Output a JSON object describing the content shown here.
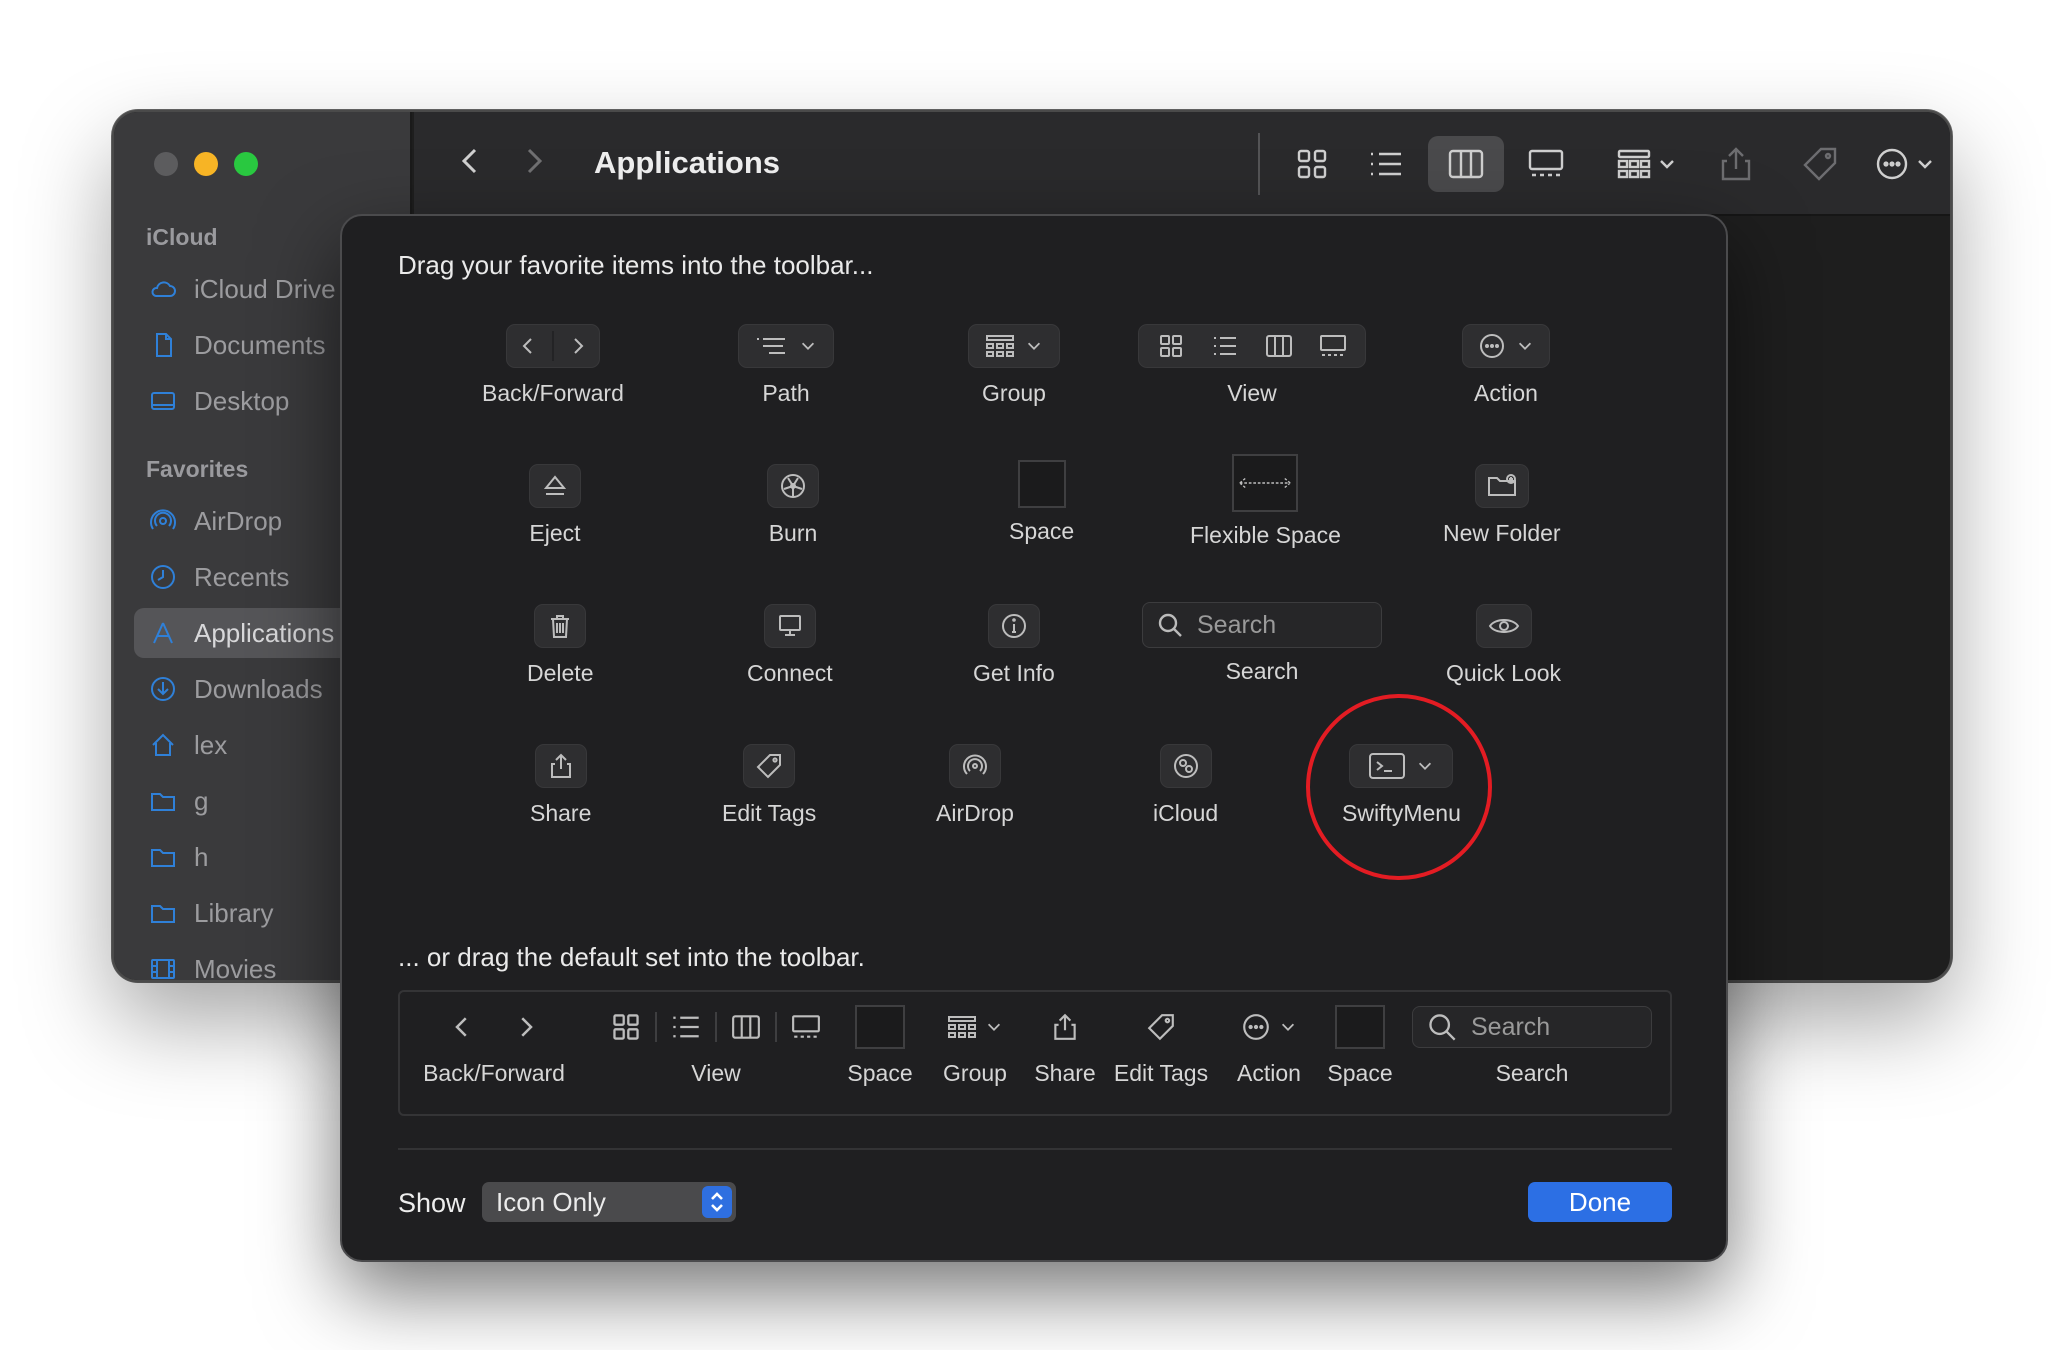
{
  "finder": {
    "title": "Applications",
    "sidebar": {
      "icloud_heading": "iCloud",
      "icloud_items": [
        {
          "label": "iCloud Drive",
          "icon": "cloud-icon"
        },
        {
          "label": "Documents",
          "icon": "document-icon"
        },
        {
          "label": "Desktop",
          "icon": "desktop-icon"
        }
      ],
      "favorites_heading": "Favorites",
      "favorite_items": [
        {
          "label": "AirDrop",
          "icon": "airdrop-icon"
        },
        {
          "label": "Recents",
          "icon": "clock-icon"
        },
        {
          "label": "Applications",
          "icon": "applications-icon",
          "selected": true
        },
        {
          "label": "Downloads",
          "icon": "download-icon"
        },
        {
          "label": "lex",
          "icon": "home-icon"
        },
        {
          "label": "g",
          "icon": "folder-icon"
        },
        {
          "label": "h",
          "icon": "folder-icon"
        },
        {
          "label": "Library",
          "icon": "folder-icon"
        },
        {
          "label": "Movies",
          "icon": "film-icon"
        }
      ]
    },
    "toolbar": {
      "view_modes": [
        "icon-view",
        "list-view",
        "column-view",
        "gallery-view"
      ],
      "selected_view": "column-view"
    }
  },
  "customize": {
    "instruction": "Drag your favorite items into the toolbar...",
    "palette": {
      "back_forward": "Back/Forward",
      "path": "Path",
      "group": "Group",
      "view": "View",
      "action": "Action",
      "eject": "Eject",
      "burn": "Burn",
      "space": "Space",
      "flexible_space": "Flexible Space",
      "new_folder": "New Folder",
      "delete": "Delete",
      "connect": "Connect",
      "get_info": "Get Info",
      "search_placeholder": "Search",
      "search": "Search",
      "quick_look": "Quick Look",
      "share": "Share",
      "edit_tags": "Edit Tags",
      "airdrop": "AirDrop",
      "icloud": "iCloud",
      "swiftymenu": "SwiftyMenu"
    },
    "default_instruction": "... or drag the default set into the toolbar.",
    "default_set": {
      "back_forward": "Back/Forward",
      "view": "View",
      "space1": "Space",
      "group": "Group",
      "share": "Share",
      "edit_tags": "Edit Tags",
      "action": "Action",
      "space2": "Space",
      "search_placeholder": "Search",
      "search": "Search"
    },
    "show_label": "Show",
    "show_value": "Icon Only",
    "done_label": "Done",
    "highlight_color": "#e31c23",
    "accent_color": "#2c6fe4"
  }
}
